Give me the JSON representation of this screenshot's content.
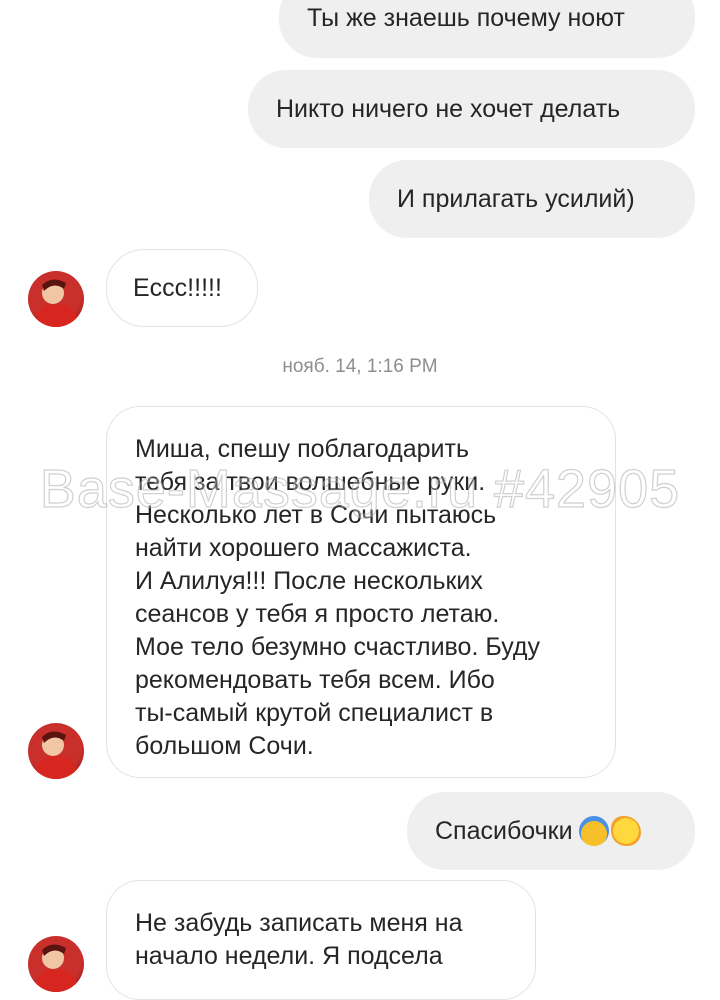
{
  "messages": {
    "out1": "Ты же знаешь почему ноют",
    "out2": "Никто ничего не хочет делать",
    "out3": "И прилагать усилий)",
    "in1": "Еccc!!!!!",
    "timestamp": "нояб. 14, 1:16 PM",
    "in2_lines": [
      "Миша, спешу поблагодарить",
      "тебя за твои волшебные руки.",
      "Несколько лет в Сочи пытаюсь",
      "найти хорошего массажиста.",
      "И Алилуя!!! После нескольких",
      "сеансов у тебя я просто летаю.",
      "Мое тело безумно счастливо. Буду",
      "рекомендовать тебя всем. Ибо",
      "ты-самый крутой специалист в",
      "большом Сочи."
    ],
    "out4": "Спасибочки",
    "out4_emojis": [
      "scared-face-emoji",
      "chick-emoji"
    ],
    "in3_lines": [
      "Не забудь записать меня на",
      "начало недели. Я подсела"
    ]
  },
  "watermark": "Base-Massage.ru #42905",
  "colors": {
    "outgoing_bubble": "#efefef",
    "incoming_border": "#e3e3e3",
    "timestamp": "#8e8e8e"
  }
}
